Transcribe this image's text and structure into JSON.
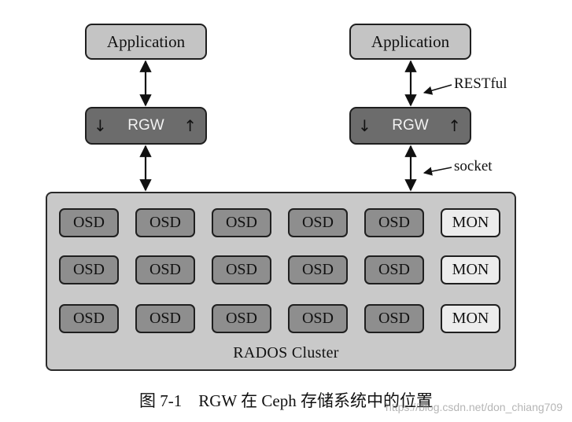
{
  "diagram": {
    "applications": [
      "Application",
      "Application"
    ],
    "rgw": {
      "label": "RGW",
      "arrow_down": "↓",
      "arrow_up": "↑"
    },
    "edge_labels": {
      "restful": "RESTful",
      "socket": "socket"
    },
    "cluster": {
      "label": "RADOS Cluster",
      "rows": [
        [
          "OSD",
          "OSD",
          "OSD",
          "OSD",
          "OSD",
          "MON"
        ],
        [
          "OSD",
          "OSD",
          "OSD",
          "OSD",
          "OSD",
          "MON"
        ],
        [
          "OSD",
          "OSD",
          "OSD",
          "OSD",
          "OSD",
          "MON"
        ]
      ]
    },
    "caption": "图 7-1　RGW 在 Ceph 存储系统中的位置",
    "watermark": "https://blog.csdn.net/don_chiang709"
  },
  "colors": {
    "application_fill": "#c4c4c4",
    "rgw_fill": "#6c6c6c",
    "osd_fill": "#8e8e8e",
    "mon_fill": "#ececec",
    "cluster_fill": "#c9c9c9"
  }
}
